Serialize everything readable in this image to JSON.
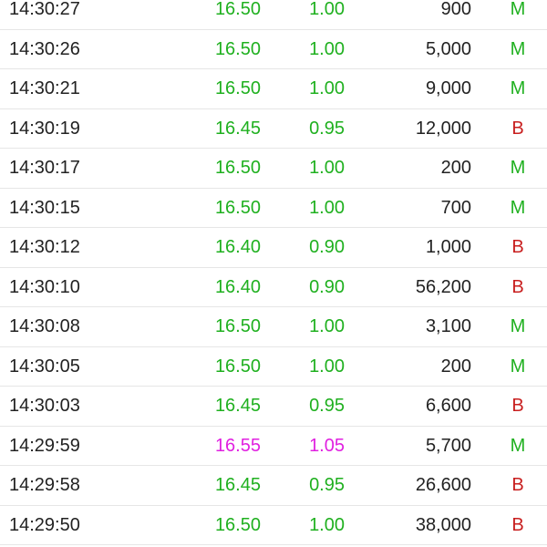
{
  "colors": {
    "up": "#1fb01f",
    "limit_up": "#e020e0",
    "buy_side": "#1fb01f",
    "sell_side": "#c81e1e",
    "text": "#222222"
  },
  "trades": [
    {
      "time": "14:30:27",
      "price": "16.50",
      "change": "1.00",
      "volume": "900",
      "side": "M",
      "price_color": "up"
    },
    {
      "time": "14:30:26",
      "price": "16.50",
      "change": "1.00",
      "volume": "5,000",
      "side": "M",
      "price_color": "up"
    },
    {
      "time": "14:30:21",
      "price": "16.50",
      "change": "1.00",
      "volume": "9,000",
      "side": "M",
      "price_color": "up"
    },
    {
      "time": "14:30:19",
      "price": "16.45",
      "change": "0.95",
      "volume": "12,000",
      "side": "B",
      "price_color": "up"
    },
    {
      "time": "14:30:17",
      "price": "16.50",
      "change": "1.00",
      "volume": "200",
      "side": "M",
      "price_color": "up"
    },
    {
      "time": "14:30:15",
      "price": "16.50",
      "change": "1.00",
      "volume": "700",
      "side": "M",
      "price_color": "up"
    },
    {
      "time": "14:30:12",
      "price": "16.40",
      "change": "0.90",
      "volume": "1,000",
      "side": "B",
      "price_color": "up"
    },
    {
      "time": "14:30:10",
      "price": "16.40",
      "change": "0.90",
      "volume": "56,200",
      "side": "B",
      "price_color": "up"
    },
    {
      "time": "14:30:08",
      "price": "16.50",
      "change": "1.00",
      "volume": "3,100",
      "side": "M",
      "price_color": "up"
    },
    {
      "time": "14:30:05",
      "price": "16.50",
      "change": "1.00",
      "volume": "200",
      "side": "M",
      "price_color": "up"
    },
    {
      "time": "14:30:03",
      "price": "16.45",
      "change": "0.95",
      "volume": "6,600",
      "side": "B",
      "price_color": "up"
    },
    {
      "time": "14:29:59",
      "price": "16.55",
      "change": "1.05",
      "volume": "5,700",
      "side": "M",
      "price_color": "limit_up"
    },
    {
      "time": "14:29:58",
      "price": "16.45",
      "change": "0.95",
      "volume": "26,600",
      "side": "B",
      "price_color": "up"
    },
    {
      "time": "14:29:50",
      "price": "16.50",
      "change": "1.00",
      "volume": "38,000",
      "side": "B",
      "price_color": "up"
    }
  ]
}
